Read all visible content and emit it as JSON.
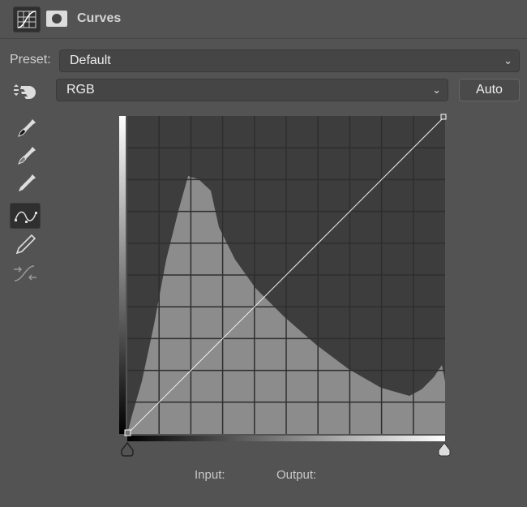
{
  "header": {
    "title": "Curves",
    "curves_icon": "curves-adjustment-icon",
    "mask_icon": "layer-mask-icon"
  },
  "preset": {
    "label": "Preset:",
    "value": "Default"
  },
  "channel": {
    "value": "RGB"
  },
  "auto_label": "Auto",
  "tools": [
    "target-adjust-hand-icon",
    "black-point-eyedropper-icon",
    "gray-point-eyedropper-icon",
    "white-point-eyedropper-icon",
    "curve-point-icon",
    "pencil-icon",
    "smooth-curve-icon"
  ],
  "footer": {
    "input_label": "Input:",
    "output_label": "Output:"
  },
  "curve": {
    "points": [
      [
        0,
        0
      ],
      [
        255,
        255
      ]
    ]
  },
  "colors": {
    "panel": "#535353",
    "histogram": "#8c8c8c",
    "graph_bg": "#3d3d3d"
  }
}
